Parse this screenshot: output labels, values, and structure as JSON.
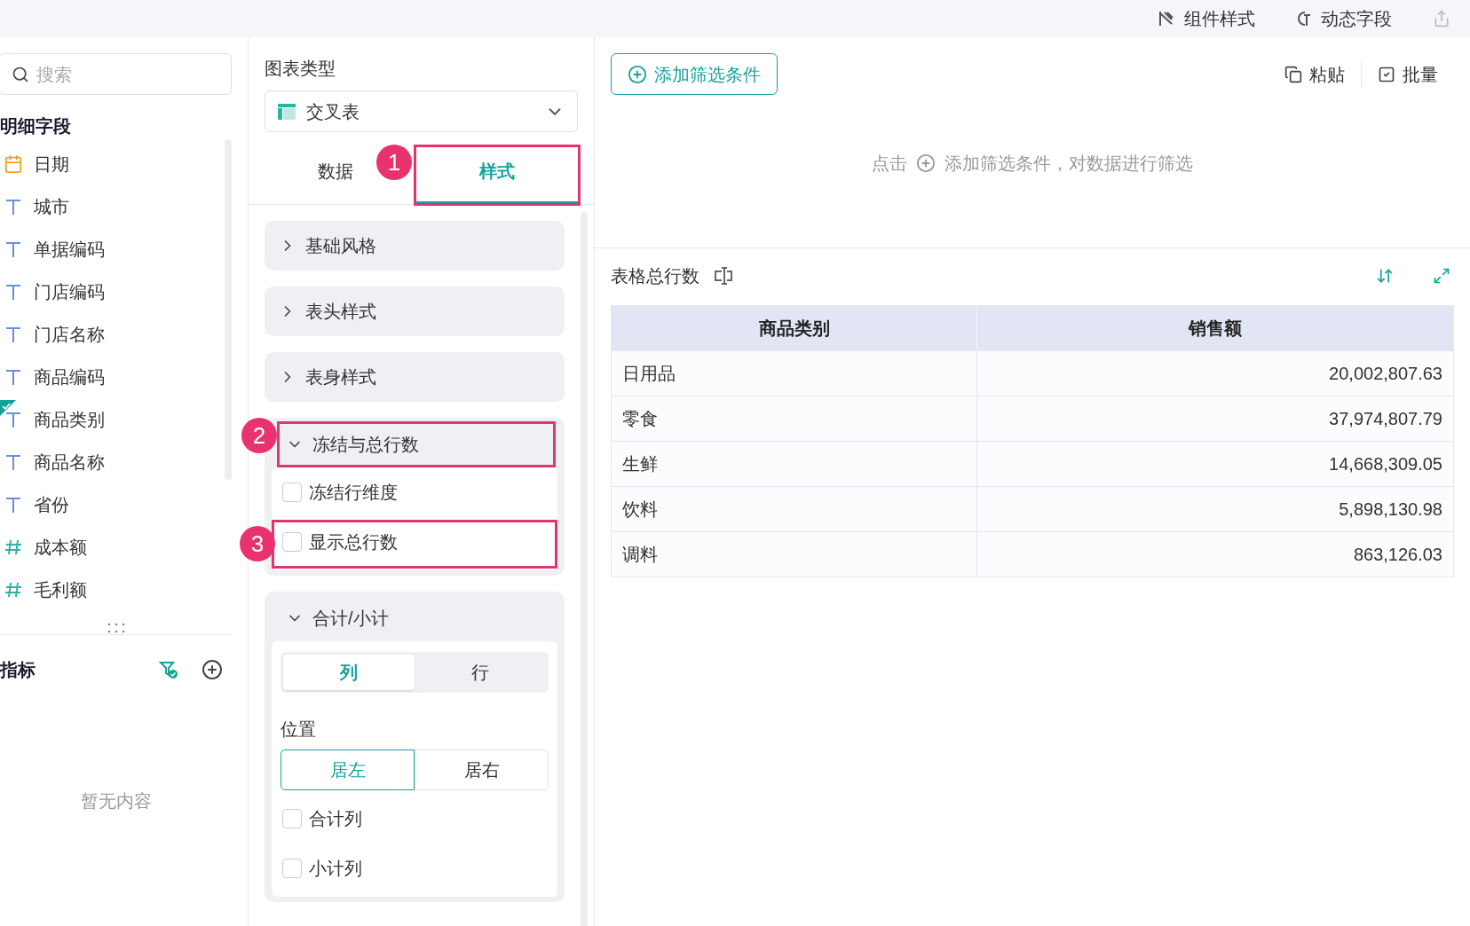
{
  "toolbar": {
    "items": [
      {
        "kind": "style",
        "label": "组件样式"
      },
      {
        "kind": "dynamic",
        "label": "动态字段"
      },
      {
        "kind": "export"
      }
    ]
  },
  "fields_panel": {
    "search": {
      "placeholder": "搜索"
    },
    "title": "明细字段",
    "items": [
      {
        "kind": "date",
        "label": "日期",
        "used": false
      },
      {
        "kind": "text",
        "label": "城市",
        "used": false
      },
      {
        "kind": "text",
        "label": "单据编码",
        "used": false
      },
      {
        "kind": "text",
        "label": "门店编码",
        "used": false
      },
      {
        "kind": "text",
        "label": "门店名称",
        "used": false
      },
      {
        "kind": "text",
        "label": "商品编码",
        "used": false
      },
      {
        "kind": "text",
        "label": "商品类别",
        "used": true
      },
      {
        "kind": "text",
        "label": "商品名称",
        "used": false
      },
      {
        "kind": "text",
        "label": "省份",
        "used": false
      },
      {
        "kind": "number",
        "label": "成本额",
        "used": false
      },
      {
        "kind": "number",
        "label": "毛利额",
        "used": false
      }
    ],
    "metrics": {
      "title": "指标",
      "empty_text": "暂无内容"
    }
  },
  "config_panel": {
    "chart_type_label": "图表类型",
    "chart_type": "交叉表",
    "tabs": [
      {
        "label": "数据",
        "selected": false
      },
      {
        "label": "样式",
        "selected": true,
        "annotation": "1"
      }
    ],
    "sections": [
      {
        "title": "基础风格",
        "expanded": false
      },
      {
        "title": "表头样式",
        "expanded": false
      },
      {
        "title": "表身样式",
        "expanded": false
      },
      {
        "title": "冻结与总行数",
        "expanded": true,
        "annotation": "2",
        "options": [
          {
            "label": "冻结行维度",
            "checked": false
          },
          {
            "label": "显示总行数",
            "checked": false,
            "annotation": "3"
          }
        ]
      },
      {
        "title": "合计/小计",
        "expanded": true,
        "segments": [
          {
            "label": "列",
            "selected": true
          },
          {
            "label": "行",
            "selected": false
          }
        ],
        "position_label": "位置",
        "positions": [
          {
            "label": "居左",
            "selected": true
          },
          {
            "label": "居右",
            "selected": false
          }
        ],
        "options": [
          {
            "label": "合计列",
            "checked": false
          },
          {
            "label": "小计列",
            "checked": false
          }
        ]
      }
    ]
  },
  "filter": {
    "add_button": "添加筛选条件",
    "actions": [
      {
        "kind": "paste",
        "label": "粘贴"
      },
      {
        "kind": "batch",
        "label": "批量"
      }
    ],
    "hint_prefix": "点击",
    "hint": "添加筛选条件，对数据进行筛选"
  },
  "table": {
    "title": "表格总行数",
    "columns": [
      "商品类别",
      "销售额"
    ],
    "rows": [
      [
        "日用品",
        "20,002,807.63"
      ],
      [
        "零食",
        "37,974,807.79"
      ],
      [
        "生鲜",
        "14,668,309.05"
      ],
      [
        "饮料",
        "5,898,130.98"
      ],
      [
        "调料",
        "863,126.03"
      ]
    ]
  }
}
